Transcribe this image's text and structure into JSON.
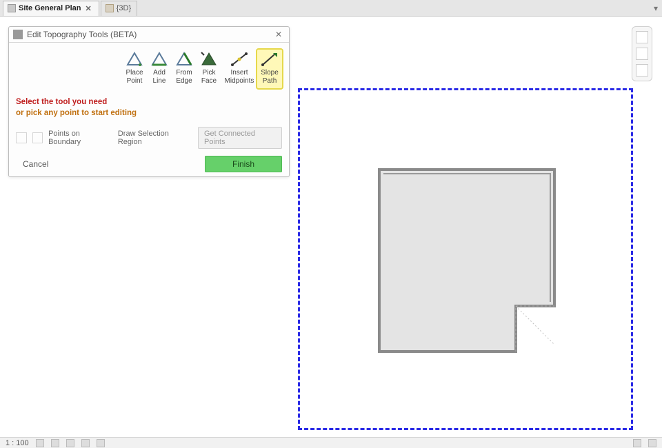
{
  "tabs": {
    "items": [
      {
        "label": "Site General Plan",
        "active": true,
        "icon": "document-icon"
      },
      {
        "label": "{3D}",
        "active": false,
        "icon": "cube-icon"
      }
    ]
  },
  "dialog": {
    "title": "Edit Topography Tools (BETA)",
    "tools": [
      {
        "name": "place-point",
        "label1": "Place",
        "label2": "Point"
      },
      {
        "name": "add-line",
        "label1": "Add",
        "label2": "Line"
      },
      {
        "name": "from-edge",
        "label1": "From",
        "label2": "Edge"
      },
      {
        "name": "pick-face",
        "label1": "Pick",
        "label2": "Face"
      },
      {
        "name": "insert-midpoints",
        "label1": "Insert",
        "label2": "Midpoints"
      },
      {
        "name": "slope-path",
        "label1": "Slope",
        "label2": "Path"
      }
    ],
    "hint_line1": "Select the tool you need",
    "hint_line2": "or pick any point to start editing",
    "mid_points_on_boundary": "Points on Boundary",
    "mid_draw_selection": "Draw Selection Region",
    "mid_get_connected": "Get Connected Points",
    "cancel_label": "Cancel",
    "finish_label": "Finish"
  },
  "status": {
    "scale": "1 : 100"
  },
  "colors": {
    "dashed_border": "#2a2ae6",
    "finish_bg": "#66d06a",
    "warn1": "#c02020",
    "warn2": "#c07010"
  }
}
